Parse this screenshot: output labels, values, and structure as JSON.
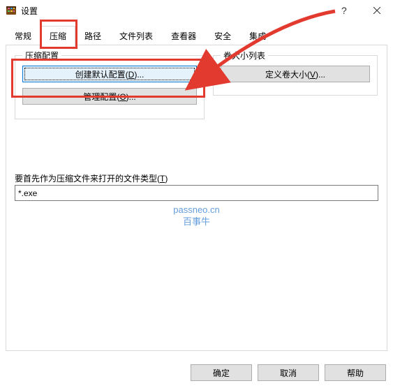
{
  "window": {
    "title": "设置"
  },
  "tabs": {
    "general": "常规",
    "compress": "压缩",
    "path": "路径",
    "filelist": "文件列表",
    "viewer": "查看器",
    "security": "安全",
    "integration": "集成"
  },
  "group_compress": {
    "legend": "压缩配置",
    "create_default": "创建默认配置(D)...",
    "manage": "管理配置(O)..."
  },
  "group_volume": {
    "legend": "卷大小列表",
    "define": "定义卷大小(V)..."
  },
  "open_as_archive": {
    "label": "要首先作为压缩文件来打开的文件类型(T)",
    "value": "*.exe"
  },
  "watermark": {
    "line1": "passneo.cn",
    "line2": "百事牛"
  },
  "buttons": {
    "ok": "确定",
    "cancel": "取消",
    "help": "帮助"
  }
}
